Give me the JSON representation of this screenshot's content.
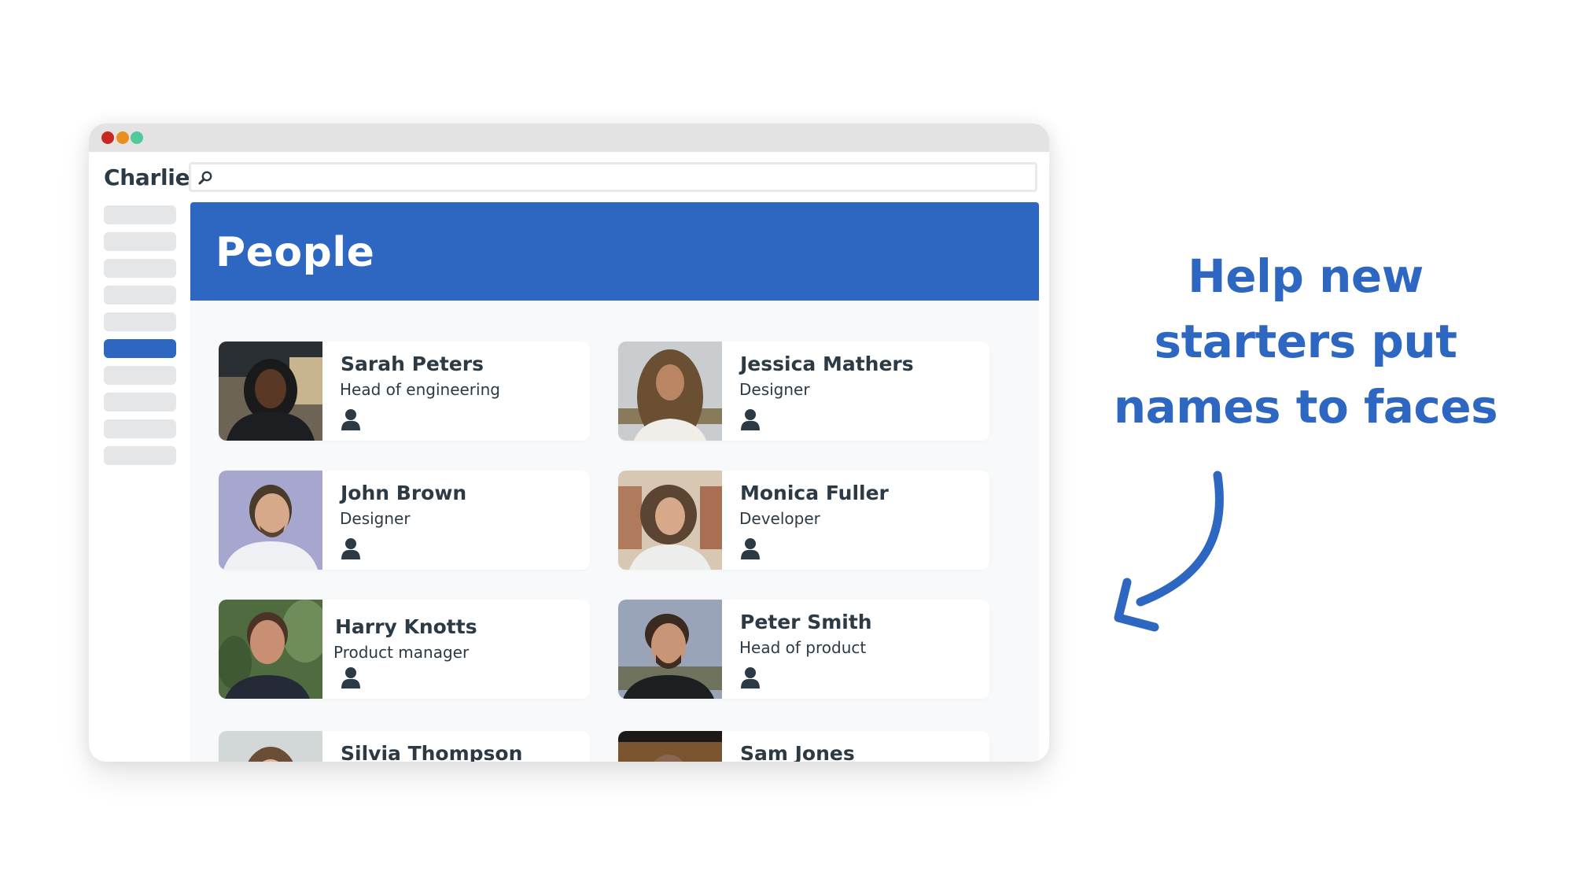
{
  "window": {
    "traffic_lights": [
      "close",
      "minimize",
      "maximize"
    ],
    "app_name": "Charlie",
    "search": {
      "placeholder": "",
      "value": "",
      "icon": "search-icon"
    }
  },
  "sidebar": {
    "item_count": 10,
    "active_index": 5
  },
  "page": {
    "title": "People"
  },
  "people": [
    {
      "name": "Sarah Peters",
      "role": "Head of engineering",
      "icon": "person-icon"
    },
    {
      "name": "Jessica Mathers",
      "role": "Designer",
      "icon": "person-icon"
    },
    {
      "name": "John Brown",
      "role": "Designer",
      "icon": "person-icon"
    },
    {
      "name": "Monica Fuller",
      "role": "Developer",
      "icon": "person-icon"
    },
    {
      "name": "Harry Knotts",
      "role": "Product manager",
      "icon": "person-icon"
    },
    {
      "name": "Peter Smith",
      "role": "Head of product",
      "icon": "person-icon"
    },
    {
      "name": "Silvia Thompson",
      "role": "",
      "icon": "person-icon"
    },
    {
      "name": "Sam Jones",
      "role": "",
      "icon": "person-icon"
    }
  ],
  "marketing": {
    "tagline_lines": [
      "Help new",
      "starters put",
      "names to faces"
    ],
    "arrow_icon": "curved-arrow-icon",
    "accent_color": "#2d67c2"
  },
  "colors": {
    "accent": "#2d67c2",
    "text_dark": "#2c3a45",
    "dot_red": "#c8281f",
    "dot_orange": "#e98f22",
    "dot_green": "#53c99b"
  }
}
